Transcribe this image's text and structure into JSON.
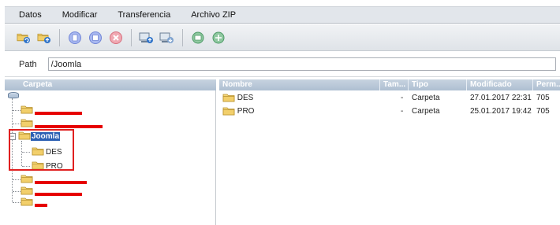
{
  "menubar": {
    "items": [
      "Datos",
      "Modificar",
      "Transferencia",
      "Archivo ZIP"
    ]
  },
  "toolbar": {
    "groups": [
      [
        "folder-refresh-icon",
        "folder-upload-icon"
      ],
      [
        "copy-icon",
        "paste-icon",
        "delete-icon"
      ],
      [
        "upload-server-icon",
        "download-server-icon"
      ],
      [
        "zip-extract-icon",
        "zip-create-icon"
      ]
    ]
  },
  "path": {
    "label": "Path",
    "value": "/Joomla"
  },
  "left_pane": {
    "header": "Carpeta",
    "selected": "Joomla",
    "children": [
      "DES",
      "PRO"
    ]
  },
  "right_pane": {
    "columns": [
      "Nombre",
      "Tam...",
      "Tipo",
      "Modificado",
      "Perm..."
    ],
    "rows": [
      {
        "name": "DES",
        "size": "-",
        "type": "Carpeta",
        "modified": "27.01.2017 22:31",
        "perm": "705"
      },
      {
        "name": "PRO",
        "size": "-",
        "type": "Carpeta",
        "modified": "25.01.2017 19:42",
        "perm": "705"
      }
    ]
  },
  "colors": {
    "header_bar": "#aebfd1",
    "selection": "#2b5fb3",
    "redaction": "#e60000",
    "annotation": "#e02020",
    "folder": "#f2cf6b"
  }
}
